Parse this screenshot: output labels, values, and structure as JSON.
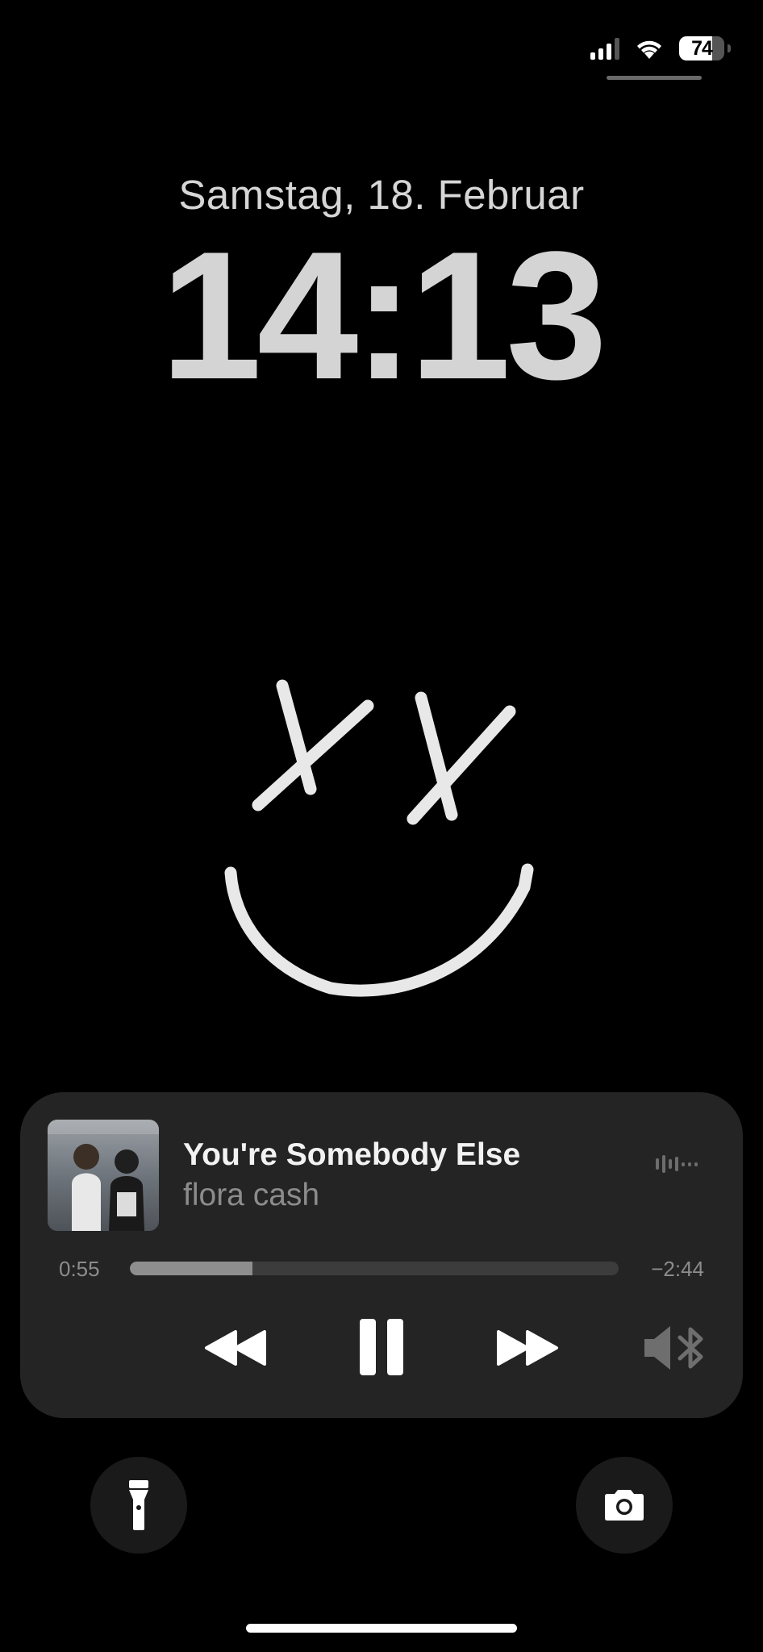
{
  "status_bar": {
    "battery_percent": "74",
    "battery_level": 0.74,
    "signal_bars_active": 3,
    "wifi_icon": "wifi-icon"
  },
  "lockscreen": {
    "date": "Samstag, 18. Februar",
    "time": "14:13"
  },
  "now_playing": {
    "title": "You're Somebody Else",
    "artist": "flora cash",
    "elapsed": "0:55",
    "remaining": "−2:44",
    "progress": 0.25,
    "controls": {
      "rewind_icon": "rewind-icon",
      "pause_icon": "pause-icon",
      "forward_icon": "fast-forward-icon",
      "output_icon": "speaker-bluetooth-icon",
      "waveform_icon": "waveform-icon"
    }
  },
  "quick_actions": {
    "left_icon": "flashlight-icon",
    "right_icon": "camera-icon"
  },
  "colors": {
    "background": "#000000",
    "clock": "#d4d4d4",
    "widget": "#242424",
    "secondary_text": "#8c8c8c"
  }
}
